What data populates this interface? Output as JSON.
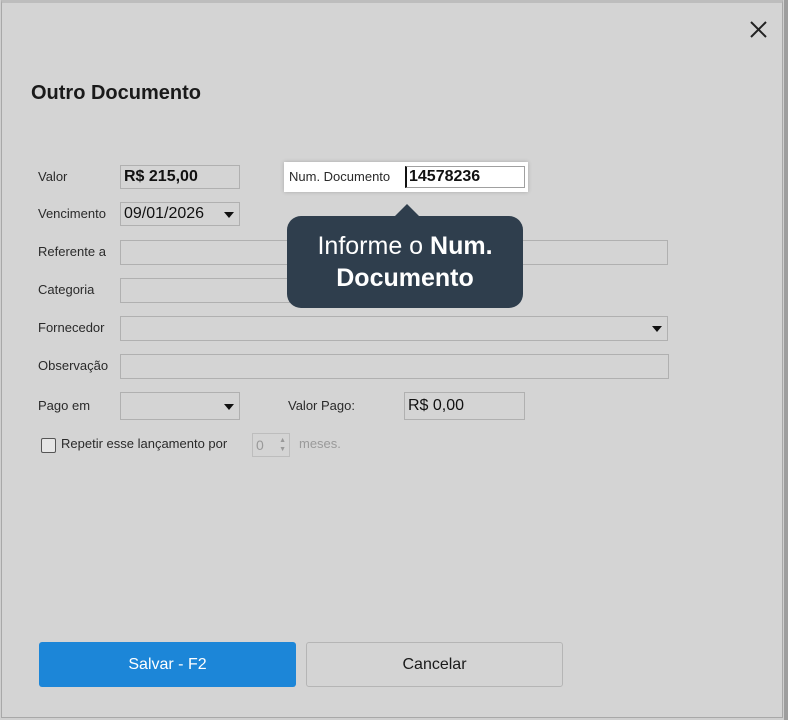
{
  "dialog": {
    "title": "Outro Documento"
  },
  "form": {
    "valor_label": "Valor",
    "valor_value": "R$ 215,00",
    "num_documento_label": "Num. Documento",
    "num_documento_value": "14578236",
    "vencimento_label": "Vencimento",
    "vencimento_value": "09/01/2026",
    "referente_label": "Referente a",
    "referente_value": "",
    "categoria_label": "Categoria",
    "categoria_value": "",
    "fornecedor_label": "Fornecedor",
    "fornecedor_value": "",
    "observacao_label": "Observação",
    "observacao_value": "",
    "pago_em_label": "Pago em",
    "pago_em_value": "",
    "valor_pago_label": "Valor Pago:",
    "valor_pago_value": "R$ 0,00",
    "repetir_label": "Repetir esse lançamento por",
    "repetir_checked": false,
    "repetir_count": "0",
    "meses_label": "meses."
  },
  "tooltip": {
    "text_normal": "Informe o ",
    "text_bold_1": "Num.",
    "text_bold_2": "Documento"
  },
  "buttons": {
    "save_label": "Salvar - F2",
    "cancel_label": "Cancelar"
  },
  "colors": {
    "primary": "#1c86d8",
    "tooltip_bg": "#2f3e4d",
    "dialog_bg": "#d4d4d4"
  }
}
